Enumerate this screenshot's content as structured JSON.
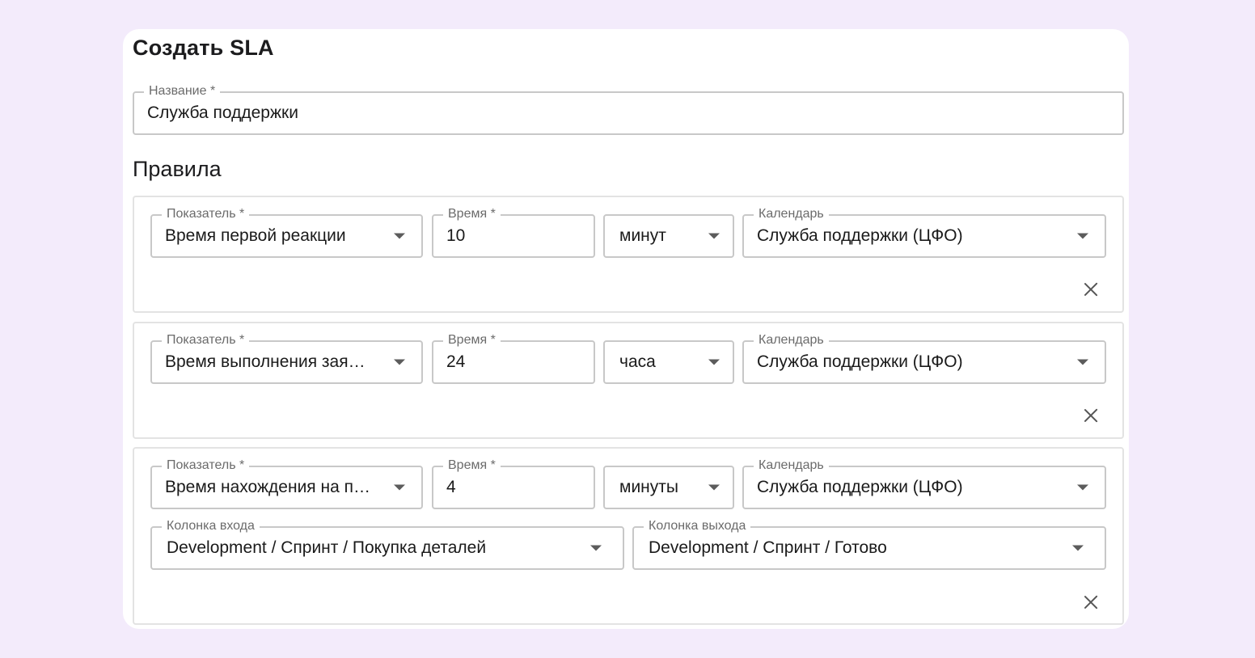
{
  "form": {
    "title": "Создать SLA",
    "name_field": {
      "label": "Название *",
      "value": "Служба поддержки"
    },
    "rules_title": "Правила"
  },
  "rules": [
    {
      "metric": {
        "label": "Показатель *",
        "value": "Время первой реакции"
      },
      "time": {
        "label": "Время *",
        "value": "10"
      },
      "unit": {
        "value": "минут"
      },
      "calendar": {
        "label": "Календарь",
        "value": "Служба поддержки (ЦФО)"
      }
    },
    {
      "metric": {
        "label": "Показатель *",
        "value": "Время выполнения зая…"
      },
      "time": {
        "label": "Время *",
        "value": "24"
      },
      "unit": {
        "value": "часа"
      },
      "calendar": {
        "label": "Календарь",
        "value": "Служба поддержки (ЦФО)"
      }
    },
    {
      "metric": {
        "label": "Показатель *",
        "value": "Время нахождения на п…"
      },
      "time": {
        "label": "Время *",
        "value": "4"
      },
      "unit": {
        "value": "минуты"
      },
      "calendar": {
        "label": "Календарь",
        "value": "Служба поддержки (ЦФО)"
      },
      "entry_column": {
        "label": "Колонка входа",
        "value": "Development / Спринт / Покупка деталей"
      },
      "exit_column": {
        "label": "Колонка выхода",
        "value": "Development / Спринт / Готово"
      }
    }
  ],
  "icons": {
    "dropdown": "chevron-down-icon",
    "remove": "close-icon"
  },
  "colors": {
    "page_background": "#f3ebfb",
    "card_background": "#ffffff",
    "field_border": "#c8c8c8",
    "label_text": "#6b6b6b"
  }
}
